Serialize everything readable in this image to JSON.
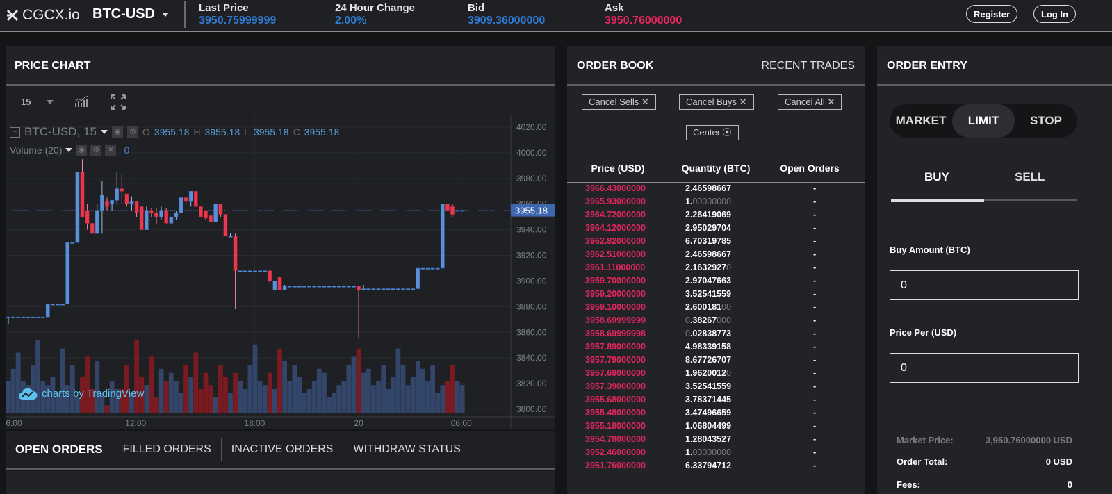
{
  "header": {
    "logo": "CGCX.io",
    "pair": "BTC-USD",
    "stats": [
      {
        "label": "Last Price",
        "value": "3950.75999999",
        "color": "#2f7bd3"
      },
      {
        "label": "24 Hour Change",
        "value": "2.00%",
        "color": "#2f7bd3"
      },
      {
        "label": "Bid",
        "value": "3909.36000000",
        "color": "#2f7bd3"
      },
      {
        "label": "Ask",
        "value": "3950.76000000",
        "color": "#e8265f"
      }
    ],
    "register": "Register",
    "login": "Log In"
  },
  "price_chart": {
    "title": "PRICE CHART",
    "interval": "15",
    "legend": {
      "symbol": "BTC-USD, 15",
      "o_label": "O",
      "o": "3955.18",
      "h_label": "H",
      "h": "3955.18",
      "l_label": "L",
      "l": "3955.18",
      "c_label": "C",
      "c": "3955.18"
    },
    "volume_legend": {
      "label": "Volume (20)",
      "value": "0"
    },
    "watermark": "charts by TradingView",
    "current_price_label": "3955.18"
  },
  "chart_data": {
    "type": "candlestick",
    "interval_minutes": 15,
    "ylim": [
      3800,
      4020
    ],
    "y_ticks": [
      "4020.00",
      "4000.00",
      "3980.00",
      "3960.00",
      "3940.00",
      "3920.00",
      "3900.00",
      "3880.00",
      "3860.00",
      "3840.00",
      "3820.00",
      "3800.00"
    ],
    "y_tick_values": [
      4020,
      4000,
      3980,
      3960,
      3940,
      3920,
      3900,
      3880,
      3860,
      3840,
      3820,
      3800
    ],
    "x_ticks": [
      {
        "label": "6:00",
        "index": -0.5
      },
      {
        "label": "12:00",
        "index": 25.8
      },
      {
        "label": "18:00",
        "index": 49.9
      },
      {
        "label": "20",
        "index": 71
      },
      {
        "label": "06:00",
        "index": 91.8
      }
    ],
    "last_price": 3955.18,
    "candles": [
      [
        3872,
        3872,
        3866,
        3872
      ],
      [
        3872,
        3872,
        3872,
        3872
      ],
      [
        3872,
        3872,
        3872,
        3872
      ],
      [
        3872,
        3872,
        3872,
        3872
      ],
      [
        3872,
        3872,
        3872,
        3872
      ],
      [
        3872,
        3872,
        3872,
        3872
      ],
      [
        3872,
        3872,
        3872,
        3872
      ],
      [
        3872,
        3872,
        3872,
        3872
      ],
      [
        3872,
        3882,
        3872,
        3882
      ],
      [
        3882,
        3882,
        3882,
        3882
      ],
      [
        3882,
        3882,
        3882,
        3882
      ],
      [
        3882,
        3882,
        3882,
        3882
      ],
      [
        3882,
        3930,
        3882,
        3930
      ],
      [
        3930,
        3930,
        3930,
        3930
      ],
      [
        3930,
        3985,
        3930,
        3985
      ],
      [
        3985,
        3995,
        3950,
        3950
      ],
      [
        3955,
        3960,
        3940,
        3945
      ],
      [
        3945,
        3945,
        3937,
        3937
      ],
      [
        3937,
        3960,
        3937,
        3955
      ],
      [
        3955,
        3978,
        3937,
        3967
      ],
      [
        3962,
        3965,
        3955,
        3958
      ],
      [
        3960,
        3963,
        3955,
        3963
      ],
      [
        3963,
        3985,
        3960,
        3972
      ],
      [
        3972,
        3983,
        3960,
        3970
      ],
      [
        3968,
        3968,
        3958,
        3960
      ],
      [
        3960,
        3966,
        3955,
        3962
      ],
      [
        3962,
        3962,
        3950,
        3953
      ],
      [
        3958,
        3958,
        3940,
        3940
      ],
      [
        3940,
        3958,
        3940,
        3955
      ],
      [
        3955,
        3957,
        3950,
        3953
      ],
      [
        3953,
        3957,
        3944,
        3950
      ],
      [
        3950,
        3958,
        3948,
        3955
      ],
      [
        3955,
        3957,
        3945,
        3945
      ],
      [
        3945,
        3950,
        3945,
        3950
      ],
      [
        3950,
        3955,
        3948,
        3953
      ],
      [
        3953,
        3965,
        3953,
        3965
      ],
      [
        3965,
        3965,
        3960,
        3962
      ],
      [
        3962,
        3970,
        3958,
        3970
      ],
      [
        3970,
        3970,
        3958,
        3958
      ],
      [
        3958,
        3958,
        3950,
        3950
      ],
      [
        3955,
        3955,
        3948,
        3949
      ],
      [
        3951,
        3952,
        3946,
        3946
      ],
      [
        3946,
        3960,
        3946,
        3960
      ],
      [
        3960,
        3960,
        3950,
        3952
      ],
      [
        3952,
        3952,
        3935,
        3935
      ],
      [
        3935,
        3937,
        3935,
        3935
      ],
      [
        3935,
        3937,
        3878,
        3908
      ],
      [
        3908,
        3908,
        3908,
        3908
      ],
      [
        3908,
        3908,
        3908,
        3908
      ],
      [
        3908,
        3908,
        3908,
        3908
      ],
      [
        3908,
        3908,
        3908,
        3908
      ],
      [
        3908,
        3908,
        3908,
        3908
      ],
      [
        3908,
        3908,
        3908,
        3908
      ],
      [
        3908,
        3908,
        3898,
        3900
      ],
      [
        3893,
        3900,
        3890,
        3900
      ],
      [
        3903,
        3903,
        3893,
        3893
      ],
      [
        3893,
        3897,
        3893,
        3896
      ],
      [
        3896,
        3896,
        3896,
        3896
      ],
      [
        3896,
        3896,
        3896,
        3896
      ],
      [
        3896,
        3896,
        3896,
        3896
      ],
      [
        3896,
        3896,
        3896,
        3896
      ],
      [
        3896,
        3896,
        3896,
        3896
      ],
      [
        3896,
        3896,
        3896,
        3896
      ],
      [
        3896,
        3896,
        3896,
        3896
      ],
      [
        3896,
        3896,
        3896,
        3896
      ],
      [
        3896,
        3896,
        3896,
        3896
      ],
      [
        3896,
        3896,
        3896,
        3896
      ],
      [
        3896,
        3896,
        3896,
        3896
      ],
      [
        3896,
        3896,
        3896,
        3896
      ],
      [
        3896,
        3896,
        3896,
        3896
      ],
      [
        3896,
        3896,
        3896,
        3896
      ],
      [
        3896,
        3896,
        3856,
        3893
      ],
      [
        3893,
        3897,
        3893,
        3894
      ],
      [
        3894,
        3894,
        3894,
        3894
      ],
      [
        3894,
        3894,
        3894,
        3894
      ],
      [
        3894,
        3894,
        3894,
        3894
      ],
      [
        3894,
        3894,
        3894,
        3894
      ],
      [
        3894,
        3894,
        3894,
        3894
      ],
      [
        3894,
        3894,
        3894,
        3894
      ],
      [
        3894,
        3894,
        3894,
        3894
      ],
      [
        3894,
        3894,
        3894,
        3894
      ],
      [
        3894,
        3894,
        3894,
        3894
      ],
      [
        3894,
        3894,
        3894,
        3894
      ],
      [
        3894,
        3910,
        3894,
        3910
      ],
      [
        3910,
        3910,
        3910,
        3910
      ],
      [
        3910,
        3910,
        3910,
        3910
      ],
      [
        3910,
        3910,
        3910,
        3910
      ],
      [
        3910,
        3910,
        3910,
        3910
      ],
      [
        3910,
        3960,
        3910,
        3960
      ],
      [
        3960,
        3960,
        3955,
        3955
      ],
      [
        3958,
        3960,
        3950,
        3952
      ],
      [
        3955.18,
        3955.18,
        3955.18,
        3955.18
      ],
      [
        3955.18,
        3955.18,
        3955.18,
        3955.18
      ]
    ],
    "volume": [
      40,
      55,
      75,
      40,
      35,
      60,
      90,
      40,
      35,
      45,
      25,
      80,
      35,
      60,
      20,
      45,
      70,
      30,
      65,
      25,
      10,
      40,
      30,
      30,
      60,
      25,
      90,
      45,
      35,
      70,
      20,
      55,
      40,
      50,
      40,
      25,
      60,
      45,
      75,
      30,
      50,
      35,
      20,
      60,
      45,
      25,
      50,
      40,
      30,
      60,
      85,
      40,
      35,
      50,
      30,
      80,
      65,
      40,
      60,
      45,
      25,
      30,
      40,
      55,
      50,
      20,
      25,
      35,
      40,
      60,
      70,
      80,
      50,
      55,
      35,
      40,
      60,
      30,
      45,
      80,
      60,
      35,
      45,
      65,
      55,
      40,
      60,
      25,
      35,
      40,
      60,
      40,
      35,
      55
    ]
  },
  "bottom_tabs": [
    "OPEN ORDERS",
    "FILLED ORDERS",
    "INACTIVE ORDERS",
    "WITHDRAW STATUS"
  ],
  "order_book": {
    "title": "ORDER BOOK",
    "recent_trades": "RECENT TRADES",
    "buttons": {
      "cancel_sells": "Cancel Sells",
      "cancel_buys": "Cancel Buys",
      "cancel_all": "Cancel All",
      "center": "Center"
    },
    "columns": [
      "Price (USD)",
      "Quantity (BTC)",
      "Open Orders"
    ],
    "rows": [
      {
        "price": "3966.43000000",
        "qty": "2.46598667",
        "qty_dim": "",
        "open": "-"
      },
      {
        "price": "3965.93000000",
        "qty": "1.",
        "qty_dim": "00000000",
        "open": "-"
      },
      {
        "price": "3964.72000000",
        "qty": "2.26419069",
        "qty_dim": "",
        "open": "-"
      },
      {
        "price": "3964.12000000",
        "qty": "2.95029704",
        "qty_dim": "",
        "open": "-"
      },
      {
        "price": "3962.82000000",
        "qty": "6.70319785",
        "qty_dim": "",
        "open": "-"
      },
      {
        "price": "3962.51000000",
        "qty": "2.46598667",
        "qty_dim": "",
        "open": "-"
      },
      {
        "price": "3961.11000000",
        "qty": "2.1632927",
        "qty_dim": "0",
        "open": "-"
      },
      {
        "price": "3959.70000000",
        "qty": "2.97047663",
        "qty_dim": "",
        "open": "-"
      },
      {
        "price": "3959.20000000",
        "qty": "3.52541559",
        "qty_dim": "",
        "open": "-"
      },
      {
        "price": "3959.10000000",
        "qty": "2.600181",
        "qty_dim": "00",
        "open": "-"
      },
      {
        "price": "3958.69999999",
        "qty_pre": "0",
        "qty": ".38267",
        "qty_dim": "000",
        "open": "-"
      },
      {
        "price": "3958.69999998",
        "qty_pre": "0",
        "qty": ".02838773",
        "qty_dim": "",
        "open": "-"
      },
      {
        "price": "3957.89000000",
        "qty": "4.98339158",
        "qty_dim": "",
        "open": "-"
      },
      {
        "price": "3957.79000000",
        "qty": "8.67726707",
        "qty_dim": "",
        "open": "-"
      },
      {
        "price": "3957.69000000",
        "qty": "1.9620012",
        "qty_dim": "0",
        "open": "-"
      },
      {
        "price": "3957.39000000",
        "qty": "3.52541559",
        "qty_dim": "",
        "open": "-"
      },
      {
        "price": "3955.68000000",
        "qty": "3.78371445",
        "qty_dim": "",
        "open": "-"
      },
      {
        "price": "3955.48000000",
        "qty": "3.47496659",
        "qty_dim": "",
        "open": "-"
      },
      {
        "price": "3955.18000000",
        "qty": "1.06804499",
        "qty_dim": "",
        "open": "-"
      },
      {
        "price": "3954.78000000",
        "qty": "1.28043527",
        "qty_dim": "",
        "open": "-"
      },
      {
        "price": "3952.46000000",
        "qty": "1.",
        "qty_dim": "00000000",
        "open": "-"
      },
      {
        "price": "3951.76000000",
        "qty": "6.33794712",
        "qty_dim": "",
        "open": "-"
      }
    ]
  },
  "order_entry": {
    "title": "ORDER ENTRY",
    "types": [
      "MARKET",
      "LIMIT",
      "STOP"
    ],
    "active_type": "LIMIT",
    "sides": [
      "BUY",
      "SELL"
    ],
    "active_side": "BUY",
    "buy_amount_label": "Buy Amount (BTC)",
    "buy_amount": "0",
    "price_label": "Price Per (USD)",
    "price": "0",
    "market_price_label": "Market Price:",
    "market_price": "3,950.76000000 USD",
    "order_total_label": "Order Total:",
    "order_total": "0 USD",
    "fees_label": "Fees:",
    "fees": "0"
  }
}
